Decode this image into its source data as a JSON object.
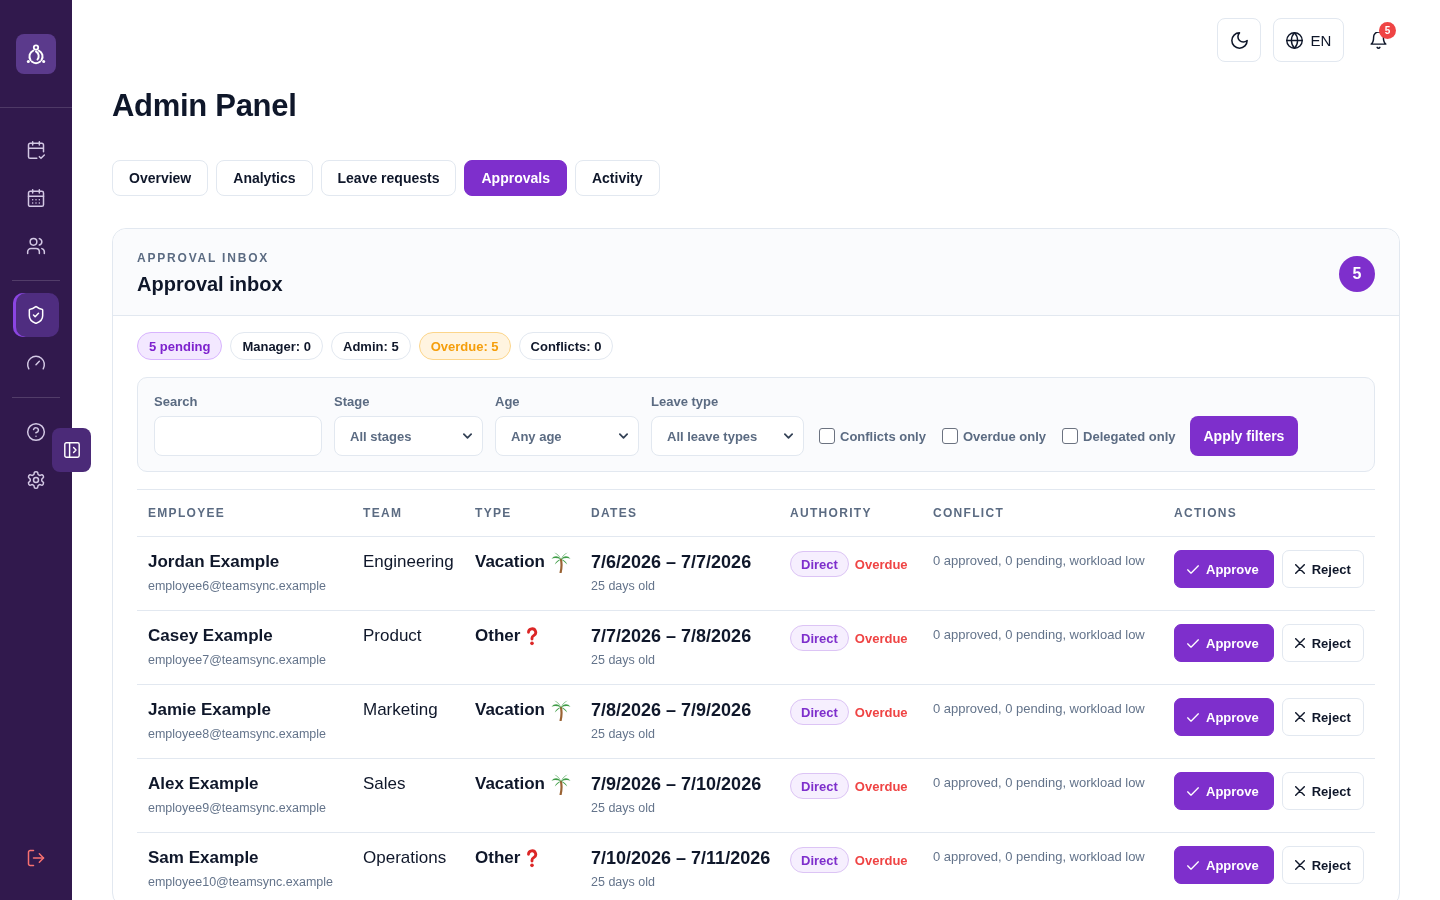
{
  "sidebar": {
    "groups": [
      {
        "items": [
          {
            "kind": "requests",
            "selected": false
          },
          {
            "kind": "calendar",
            "selected": false
          },
          {
            "kind": "team",
            "selected": false
          }
        ]
      },
      {
        "items": [
          {
            "kind": "approvals",
            "selected": true
          },
          {
            "kind": "dashboard",
            "selected": false
          }
        ]
      },
      {
        "items": [
          {
            "kind": "help",
            "selected": false
          },
          {
            "kind": "settings",
            "selected": false
          }
        ]
      }
    ]
  },
  "topbar": {
    "language": "EN",
    "notifications": "5"
  },
  "title": "Admin Panel",
  "tabs": [
    {
      "label": "Overview",
      "selected": false
    },
    {
      "label": "Analytics",
      "selected": false
    },
    {
      "label": "Leave requests",
      "selected": false
    },
    {
      "label": "Approvals",
      "selected": true
    },
    {
      "label": "Activity",
      "selected": false
    }
  ],
  "inbox": {
    "eyebrow": "APPROVAL INBOX",
    "title": "Approval inbox",
    "count": "5",
    "chips": [
      {
        "label": "5 pending",
        "kind": "accent"
      },
      {
        "label": "Manager: 0",
        "kind": "plain"
      },
      {
        "label": "Admin: 5",
        "kind": "plain"
      },
      {
        "label": "Overdue: 5",
        "kind": "warning"
      },
      {
        "label": "Conflicts: 0",
        "kind": "plain"
      }
    ],
    "filters": {
      "fields": [
        {
          "kind": "text",
          "label": "Search"
        },
        {
          "kind": "select",
          "label": "Stage",
          "value": "All stages"
        },
        {
          "kind": "select",
          "label": "Age",
          "value": "Any age"
        },
        {
          "kind": "select",
          "label": "Leave type",
          "value": "All leave types"
        }
      ],
      "checkboxes": [
        {
          "label": "Conflicts only",
          "checked": false
        },
        {
          "label": "Overdue only",
          "checked": false
        },
        {
          "label": "Delegated only",
          "checked": false
        }
      ],
      "apply": "Apply filters"
    },
    "table": {
      "columns": [
        "EMPLOYEE",
        "TEAM",
        "TYPE",
        "DATES",
        "AUTHORITY",
        "CONFLICT",
        "ACTIONS"
      ],
      "rows": [
        {
          "employee": "Jordan Example",
          "email": "employee6@teamsync.example",
          "team": "Engineering",
          "type": {
            "label": "Vacation",
            "kind": "vacation"
          },
          "dates": "7/6/2026 – 7/7/2026",
          "age": "25 days old",
          "authority": "Direct",
          "status": "Overdue",
          "conflict": "0 approved, 0 pending, workload low",
          "actions": [
            {
              "label": "Approve",
              "kind": "approve"
            },
            {
              "label": "Reject",
              "kind": "reject"
            }
          ]
        },
        {
          "employee": "Casey Example",
          "email": "employee7@teamsync.example",
          "team": "Product",
          "type": {
            "label": "Other",
            "kind": "other"
          },
          "dates": "7/7/2026 – 7/8/2026",
          "age": "25 days old",
          "authority": "Direct",
          "status": "Overdue",
          "conflict": "0 approved, 0 pending, workload low",
          "actions": [
            {
              "label": "Approve",
              "kind": "approve"
            },
            {
              "label": "Reject",
              "kind": "reject"
            }
          ]
        },
        {
          "employee": "Jamie Example",
          "email": "employee8@teamsync.example",
          "team": "Marketing",
          "type": {
            "label": "Vacation",
            "kind": "vacation"
          },
          "dates": "7/8/2026 – 7/9/2026",
          "age": "25 days old",
          "authority": "Direct",
          "status": "Overdue",
          "conflict": "0 approved, 0 pending, workload low",
          "actions": [
            {
              "label": "Approve",
              "kind": "approve"
            },
            {
              "label": "Reject",
              "kind": "reject"
            }
          ]
        },
        {
          "employee": "Alex Example",
          "email": "employee9@teamsync.example",
          "team": "Sales",
          "type": {
            "label": "Vacation",
            "kind": "vacation"
          },
          "dates": "7/9/2026 – 7/10/2026",
          "age": "25 days old",
          "authority": "Direct",
          "status": "Overdue",
          "conflict": "0 approved, 0 pending, workload low",
          "actions": [
            {
              "label": "Approve",
              "kind": "approve"
            },
            {
              "label": "Reject",
              "kind": "reject"
            }
          ]
        },
        {
          "employee": "Sam Example",
          "email": "employee10@teamsync.example",
          "team": "Operations",
          "type": {
            "label": "Other",
            "kind": "other"
          },
          "dates": "7/10/2026 – 7/11/2026",
          "age": "25 days old",
          "authority": "Direct",
          "status": "Overdue",
          "conflict": "0 approved, 0 pending, workload low",
          "actions": [
            {
              "label": "Approve",
              "kind": "approve"
            },
            {
              "label": "Reject",
              "kind": "reject"
            }
          ]
        }
      ]
    }
  }
}
